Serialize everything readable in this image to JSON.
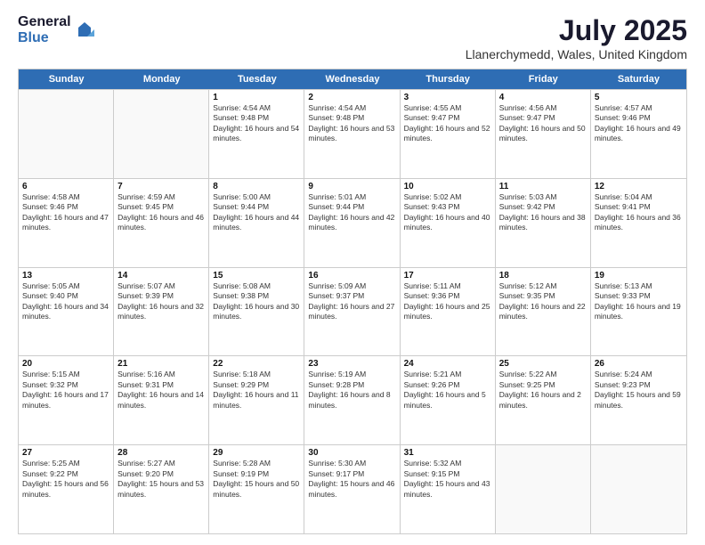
{
  "header": {
    "logo_general": "General",
    "logo_blue": "Blue",
    "month_year": "July 2025",
    "location": "Llanerchymedd, Wales, United Kingdom"
  },
  "weekdays": [
    "Sunday",
    "Monday",
    "Tuesday",
    "Wednesday",
    "Thursday",
    "Friday",
    "Saturday"
  ],
  "weeks": [
    [
      {
        "day": "",
        "sunrise": "",
        "sunset": "",
        "daylight": "",
        "empty": true
      },
      {
        "day": "",
        "sunrise": "",
        "sunset": "",
        "daylight": "",
        "empty": true
      },
      {
        "day": "1",
        "sunrise": "Sunrise: 4:54 AM",
        "sunset": "Sunset: 9:48 PM",
        "daylight": "Daylight: 16 hours and 54 minutes.",
        "empty": false
      },
      {
        "day": "2",
        "sunrise": "Sunrise: 4:54 AM",
        "sunset": "Sunset: 9:48 PM",
        "daylight": "Daylight: 16 hours and 53 minutes.",
        "empty": false
      },
      {
        "day": "3",
        "sunrise": "Sunrise: 4:55 AM",
        "sunset": "Sunset: 9:47 PM",
        "daylight": "Daylight: 16 hours and 52 minutes.",
        "empty": false
      },
      {
        "day": "4",
        "sunrise": "Sunrise: 4:56 AM",
        "sunset": "Sunset: 9:47 PM",
        "daylight": "Daylight: 16 hours and 50 minutes.",
        "empty": false
      },
      {
        "day": "5",
        "sunrise": "Sunrise: 4:57 AM",
        "sunset": "Sunset: 9:46 PM",
        "daylight": "Daylight: 16 hours and 49 minutes.",
        "empty": false
      }
    ],
    [
      {
        "day": "6",
        "sunrise": "Sunrise: 4:58 AM",
        "sunset": "Sunset: 9:46 PM",
        "daylight": "Daylight: 16 hours and 47 minutes.",
        "empty": false
      },
      {
        "day": "7",
        "sunrise": "Sunrise: 4:59 AM",
        "sunset": "Sunset: 9:45 PM",
        "daylight": "Daylight: 16 hours and 46 minutes.",
        "empty": false
      },
      {
        "day": "8",
        "sunrise": "Sunrise: 5:00 AM",
        "sunset": "Sunset: 9:44 PM",
        "daylight": "Daylight: 16 hours and 44 minutes.",
        "empty": false
      },
      {
        "day": "9",
        "sunrise": "Sunrise: 5:01 AM",
        "sunset": "Sunset: 9:44 PM",
        "daylight": "Daylight: 16 hours and 42 minutes.",
        "empty": false
      },
      {
        "day": "10",
        "sunrise": "Sunrise: 5:02 AM",
        "sunset": "Sunset: 9:43 PM",
        "daylight": "Daylight: 16 hours and 40 minutes.",
        "empty": false
      },
      {
        "day": "11",
        "sunrise": "Sunrise: 5:03 AM",
        "sunset": "Sunset: 9:42 PM",
        "daylight": "Daylight: 16 hours and 38 minutes.",
        "empty": false
      },
      {
        "day": "12",
        "sunrise": "Sunrise: 5:04 AM",
        "sunset": "Sunset: 9:41 PM",
        "daylight": "Daylight: 16 hours and 36 minutes.",
        "empty": false
      }
    ],
    [
      {
        "day": "13",
        "sunrise": "Sunrise: 5:05 AM",
        "sunset": "Sunset: 9:40 PM",
        "daylight": "Daylight: 16 hours and 34 minutes.",
        "empty": false
      },
      {
        "day": "14",
        "sunrise": "Sunrise: 5:07 AM",
        "sunset": "Sunset: 9:39 PM",
        "daylight": "Daylight: 16 hours and 32 minutes.",
        "empty": false
      },
      {
        "day": "15",
        "sunrise": "Sunrise: 5:08 AM",
        "sunset": "Sunset: 9:38 PM",
        "daylight": "Daylight: 16 hours and 30 minutes.",
        "empty": false
      },
      {
        "day": "16",
        "sunrise": "Sunrise: 5:09 AM",
        "sunset": "Sunset: 9:37 PM",
        "daylight": "Daylight: 16 hours and 27 minutes.",
        "empty": false
      },
      {
        "day": "17",
        "sunrise": "Sunrise: 5:11 AM",
        "sunset": "Sunset: 9:36 PM",
        "daylight": "Daylight: 16 hours and 25 minutes.",
        "empty": false
      },
      {
        "day": "18",
        "sunrise": "Sunrise: 5:12 AM",
        "sunset": "Sunset: 9:35 PM",
        "daylight": "Daylight: 16 hours and 22 minutes.",
        "empty": false
      },
      {
        "day": "19",
        "sunrise": "Sunrise: 5:13 AM",
        "sunset": "Sunset: 9:33 PM",
        "daylight": "Daylight: 16 hours and 19 minutes.",
        "empty": false
      }
    ],
    [
      {
        "day": "20",
        "sunrise": "Sunrise: 5:15 AM",
        "sunset": "Sunset: 9:32 PM",
        "daylight": "Daylight: 16 hours and 17 minutes.",
        "empty": false
      },
      {
        "day": "21",
        "sunrise": "Sunrise: 5:16 AM",
        "sunset": "Sunset: 9:31 PM",
        "daylight": "Daylight: 16 hours and 14 minutes.",
        "empty": false
      },
      {
        "day": "22",
        "sunrise": "Sunrise: 5:18 AM",
        "sunset": "Sunset: 9:29 PM",
        "daylight": "Daylight: 16 hours and 11 minutes.",
        "empty": false
      },
      {
        "day": "23",
        "sunrise": "Sunrise: 5:19 AM",
        "sunset": "Sunset: 9:28 PM",
        "daylight": "Daylight: 16 hours and 8 minutes.",
        "empty": false
      },
      {
        "day": "24",
        "sunrise": "Sunrise: 5:21 AM",
        "sunset": "Sunset: 9:26 PM",
        "daylight": "Daylight: 16 hours and 5 minutes.",
        "empty": false
      },
      {
        "day": "25",
        "sunrise": "Sunrise: 5:22 AM",
        "sunset": "Sunset: 9:25 PM",
        "daylight": "Daylight: 16 hours and 2 minutes.",
        "empty": false
      },
      {
        "day": "26",
        "sunrise": "Sunrise: 5:24 AM",
        "sunset": "Sunset: 9:23 PM",
        "daylight": "Daylight: 15 hours and 59 minutes.",
        "empty": false
      }
    ],
    [
      {
        "day": "27",
        "sunrise": "Sunrise: 5:25 AM",
        "sunset": "Sunset: 9:22 PM",
        "daylight": "Daylight: 15 hours and 56 minutes.",
        "empty": false
      },
      {
        "day": "28",
        "sunrise": "Sunrise: 5:27 AM",
        "sunset": "Sunset: 9:20 PM",
        "daylight": "Daylight: 15 hours and 53 minutes.",
        "empty": false
      },
      {
        "day": "29",
        "sunrise": "Sunrise: 5:28 AM",
        "sunset": "Sunset: 9:19 PM",
        "daylight": "Daylight: 15 hours and 50 minutes.",
        "empty": false
      },
      {
        "day": "30",
        "sunrise": "Sunrise: 5:30 AM",
        "sunset": "Sunset: 9:17 PM",
        "daylight": "Daylight: 15 hours and 46 minutes.",
        "empty": false
      },
      {
        "day": "31",
        "sunrise": "Sunrise: 5:32 AM",
        "sunset": "Sunset: 9:15 PM",
        "daylight": "Daylight: 15 hours and 43 minutes.",
        "empty": false
      },
      {
        "day": "",
        "sunrise": "",
        "sunset": "",
        "daylight": "",
        "empty": true
      },
      {
        "day": "",
        "sunrise": "",
        "sunset": "",
        "daylight": "",
        "empty": true
      }
    ]
  ]
}
